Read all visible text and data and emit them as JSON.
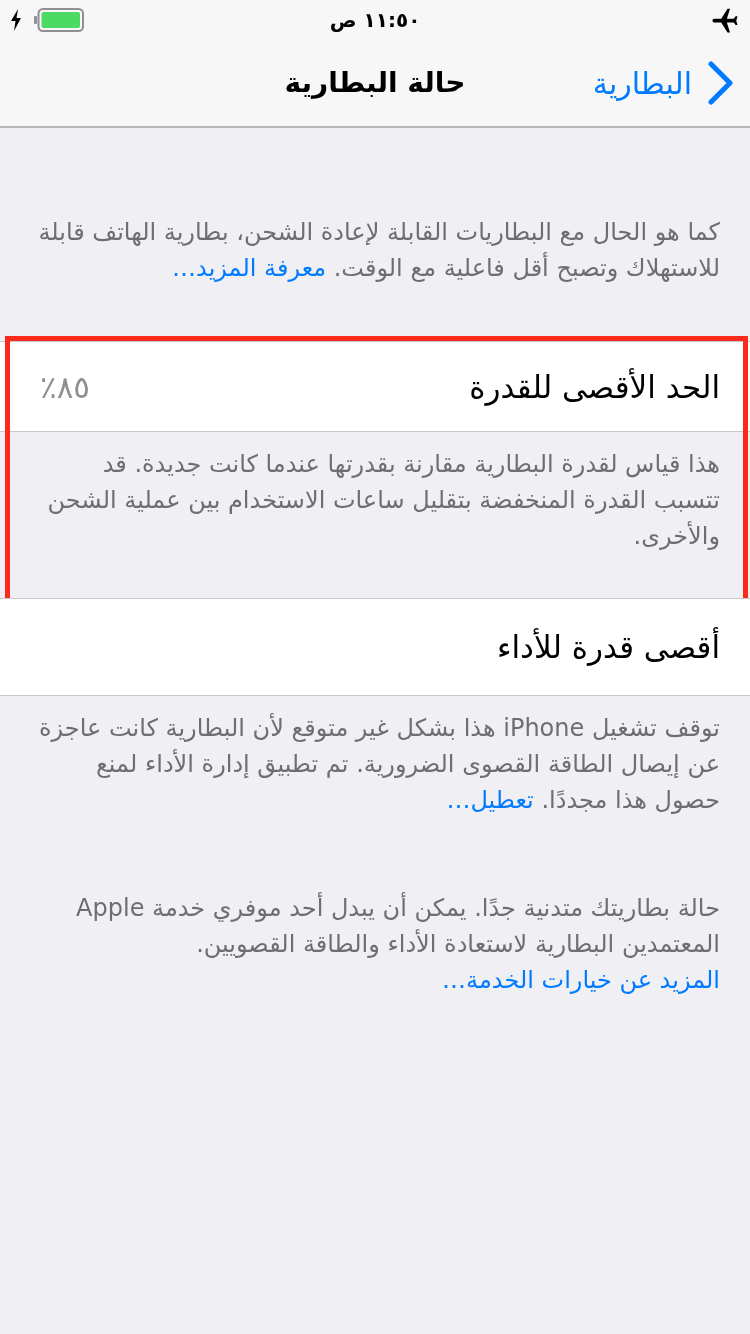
{
  "status_bar": {
    "airplane_mode": true,
    "time": "١١:٥٠ ص",
    "charging": true
  },
  "nav_bar": {
    "back_label": "البطارية",
    "title": "حالة البطارية"
  },
  "intro": {
    "text": "كما هو الحال مع البطاريات القابلة لإعادة الشحن، بطارية الهاتف قابلة للاستهلاك وتصبح أقل فاعلية مع الوقت.",
    "link": "معرفة المزيد…"
  },
  "sections": [
    {
      "highlighted": true,
      "cell": {
        "label": "الحد الأقصى للقدرة",
        "value": "٨٥٪"
      },
      "footer": {
        "text": "هذا قياس لقدرة البطارية مقارنة بقدرتها عندما كانت جديدة. قد تتسبب القدرة المنخفضة بتقليل ساعات الاستخدام بين عملية الشحن والأخرى."
      }
    },
    {
      "highlighted": false,
      "cell": {
        "label": "أقصى قدرة للأداء"
      },
      "footer": {
        "text": "توقف تشغيل iPhone هذا بشكل غير متوقع لأن البطارية كانت عاجزة عن إيصال الطاقة القصوى الضرورية. تم تطبيق إدارة الأداء لمنع حصول هذا مجددًا.",
        "link": "تعطيل…"
      }
    }
  ],
  "notice": {
    "text": "حالة بطاريتك متدنية جدًا. يمكن أن يبدل أحد موفري خدمة Apple المعتمدين البطارية لاستعادة الأداء والطاقة القصويين.",
    "link": "المزيد عن خيارات الخدمة…"
  }
}
